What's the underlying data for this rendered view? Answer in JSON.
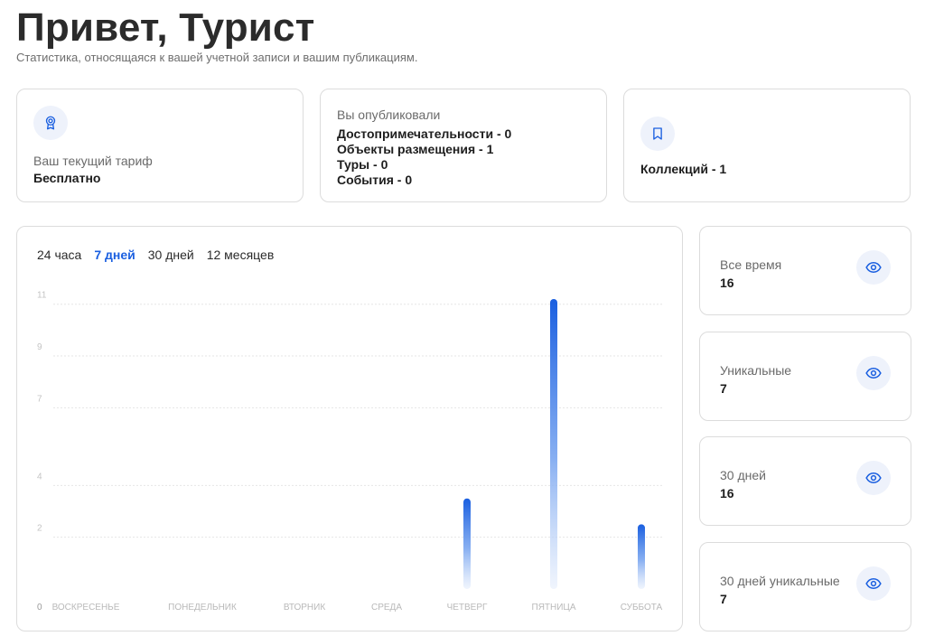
{
  "header": {
    "title": "Привет, Турист",
    "subtitle": "Статистика, относящаяся к вашей учетной записи и вашим публикациям."
  },
  "tariff": {
    "icon": "award-icon",
    "label": "Ваш текущий тариф",
    "value": "Бесплатно"
  },
  "published": {
    "label": "Вы опубликовали",
    "items": [
      "Достопримечательности - 0",
      "Объекты размещения - 1",
      "Туры - 0",
      "События - 0"
    ]
  },
  "collections": {
    "icon": "bookmark-icon",
    "value": "Коллекций - 1"
  },
  "period_tabs": {
    "items": [
      "24 часа",
      "7 дней",
      "30 дней",
      "12 месяцев"
    ],
    "active": "7 дней"
  },
  "stats": [
    {
      "label": "Все время",
      "value": "16",
      "icon": "eye-icon"
    },
    {
      "label": "Уникальные",
      "value": "7",
      "icon": "eye-icon"
    },
    {
      "label": "30 дней",
      "value": "16",
      "icon": "eye-icon"
    },
    {
      "label": "30 дней уникальные",
      "value": "7",
      "icon": "eye-icon"
    }
  ],
  "colors": {
    "accent": "#1a5fe0",
    "card_border": "#dcdcdc",
    "icon_bg": "#eef2fb"
  },
  "chart_data": {
    "type": "bar",
    "categories": [
      "ВОСКРЕСЕНЬЕ",
      "ПОНЕДЕЛЬНИК",
      "ВТОРНИК",
      "СРЕДА",
      "ЧЕТВЕРГ",
      "ПЯТНИЦА",
      "СУББОТА"
    ],
    "values": [
      0,
      0,
      0,
      0,
      3.5,
      11.2,
      2.5
    ],
    "y_ticks": [
      0,
      2,
      4,
      7,
      9,
      11
    ],
    "ylim": [
      0,
      11.2
    ],
    "grid": true,
    "title": "",
    "xlabel": "",
    "ylabel": ""
  }
}
